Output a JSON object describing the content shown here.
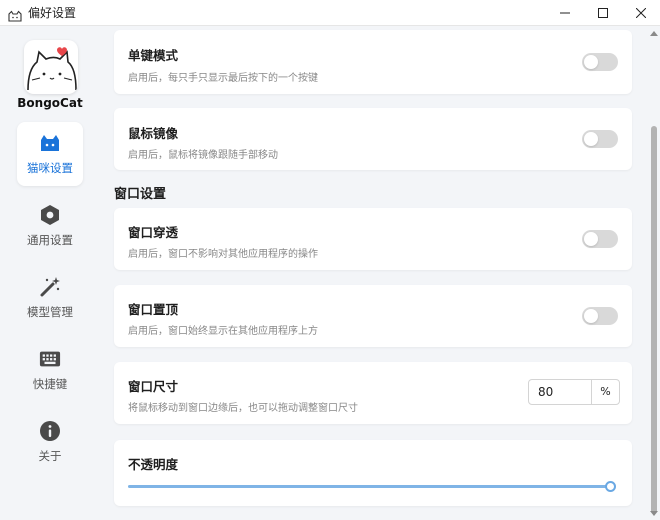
{
  "window": {
    "title": "偏好设置",
    "controls": [
      "minimize",
      "maximize",
      "close"
    ]
  },
  "sidebar": {
    "brand": "BongoCat",
    "items": [
      {
        "label": "猫咪设置",
        "icon": "cat-icon",
        "active": true
      },
      {
        "label": "通用设置",
        "icon": "hexagon-settings-icon",
        "active": false
      },
      {
        "label": "模型管理",
        "icon": "magic-wand-icon",
        "active": false
      },
      {
        "label": "快捷键",
        "icon": "keyboard-icon",
        "active": false
      },
      {
        "label": "关于",
        "icon": "info-icon",
        "active": false
      }
    ]
  },
  "main": {
    "cards": [
      {
        "title": "单键模式",
        "desc": "启用后，每只手只显示最后按下的一个按键",
        "toggle": false
      },
      {
        "title": "鼠标镜像",
        "desc": "启用后，鼠标将镜像跟随手部移动",
        "toggle": false
      }
    ],
    "section_window": "窗口设置",
    "window_cards": [
      {
        "title": "窗口穿透",
        "desc": "启用后，窗口不影响对其他应用程序的操作",
        "toggle": false
      },
      {
        "title": "窗口置顶",
        "desc": "启用后，窗口始终显示在其他应用程序上方",
        "toggle": false
      }
    ],
    "window_size": {
      "title": "窗口尺寸",
      "desc": "将鼠标移动到窗口边缘后，也可以拖动调整窗口尺寸",
      "value": "80",
      "unit": "%"
    },
    "opacity": {
      "title": "不透明度",
      "value_percent": 100
    }
  },
  "colors": {
    "accent": "#1a73d9",
    "toggle_off": "#d9d9d9",
    "slider": "#7fb4e6"
  }
}
